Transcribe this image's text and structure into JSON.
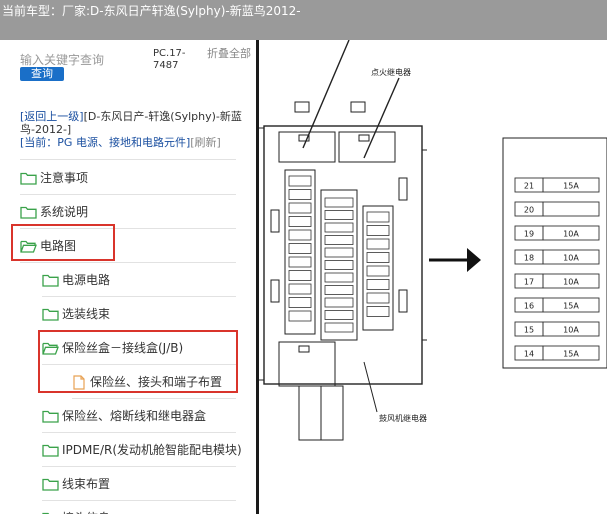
{
  "header": {
    "model_label": "当前车型：",
    "model_value": "厂家:D-东风日产轩逸(Sylphy)-新蓝鸟2012-"
  },
  "search": {
    "placeholder": "输入关键字查询",
    "button_label": "查询"
  },
  "doc_code": "PC.17-7487",
  "collapse_all_label": "折叠全部",
  "breadcrumb": {
    "back_label": "[返回上一级]",
    "back_path": "[D-东风日产-轩逸(Sylphy)-新蓝鸟-2012-]",
    "current_label": "[当前：PG 电源、接地和电路元件]",
    "refresh_label": "[刷新]"
  },
  "tree": [
    {
      "label": "注意事项",
      "level": 0,
      "icon": "folder-closed-icon"
    },
    {
      "label": "系统说明",
      "level": 0,
      "icon": "folder-closed-icon"
    },
    {
      "label": "电路图",
      "level": 0,
      "icon": "folder-open-icon",
      "highlighted": true
    },
    {
      "label": "电源电路",
      "level": 1,
      "icon": "folder-closed-icon"
    },
    {
      "label": "选装线束",
      "level": 1,
      "icon": "folder-closed-icon"
    },
    {
      "label": "保险丝盒－接线盒(J/B)",
      "level": 1,
      "icon": "folder-open-icon",
      "highlighted": true
    },
    {
      "label": "保险丝、接头和端子布置",
      "level": 2,
      "icon": "document-icon",
      "highlighted": true
    },
    {
      "label": "保险丝、熔断线和继电器盒",
      "level": 1,
      "icon": "folder-closed-icon"
    },
    {
      "label": "IPDME/R(发动机舱智能配电模块)",
      "level": 1,
      "icon": "folder-closed-icon"
    },
    {
      "label": "线束布置",
      "level": 1,
      "icon": "folder-closed-icon"
    },
    {
      "label": "接头信息",
      "level": 1,
      "icon": "folder-closed-icon"
    }
  ],
  "diagram": {
    "relay_label_top": "点火继电器",
    "relay_label_bottom": "鼓风机继电器",
    "fuses": [
      {
        "number": "21",
        "rating": "15A"
      },
      {
        "number": "20",
        "rating": ""
      },
      {
        "number": "19",
        "rating": "10A"
      },
      {
        "number": "18",
        "rating": "10A"
      },
      {
        "number": "17",
        "rating": "10A"
      },
      {
        "number": "16",
        "rating": "15A"
      },
      {
        "number": "15",
        "rating": "10A"
      },
      {
        "number": "14",
        "rating": "15A"
      }
    ]
  },
  "colors": {
    "header_bg": "#9a9a9a",
    "highlight_border": "#d9342b",
    "folder_green": "#3aa24a",
    "link_blue": "#1a4fa0",
    "button_blue": "#1a6fc8"
  }
}
